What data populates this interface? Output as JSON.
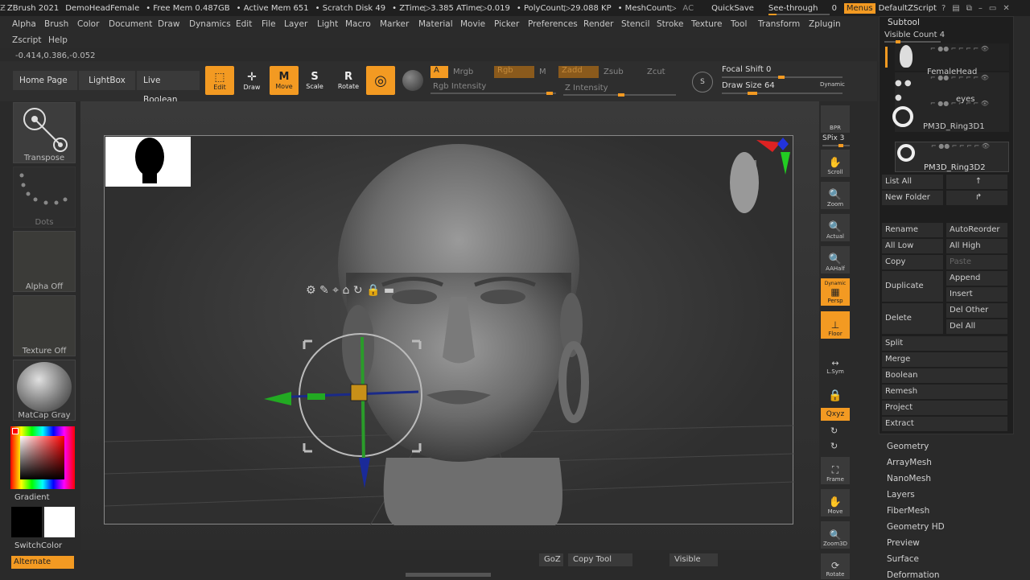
{
  "titlebar": {
    "app": "ZBrush 2021",
    "file": "DemoHeadFemale",
    "free_mem": "• Free Mem 0.487GB",
    "active_mem": "• Active Mem 651",
    "scratch": "• Scratch Disk 49",
    "ztime": "• ZTime▷3.385 ATime▷0.019",
    "polycount": "• PolyCount▷29.088 KP",
    "meshcount": "• MeshCount▷",
    "ac": "AC",
    "quicksave": "QuickSave",
    "seethrough": "See-through",
    "seethrough_value": "0",
    "menus": "Menus",
    "script": "DefaultZScript"
  },
  "menu": {
    "row1": [
      "Alpha",
      "Brush",
      "Color",
      "Document",
      "Draw",
      "Dynamics",
      "Edit",
      "File",
      "Layer",
      "Light",
      "Macro",
      "Marker",
      "Material",
      "Movie",
      "Picker",
      "Preferences",
      "Render",
      "Stencil",
      "Stroke",
      "Texture",
      "Tool",
      "Transform",
      "Zplugin"
    ],
    "row2": [
      "Zscript",
      "Help"
    ]
  },
  "coords": "-0.414,0.386,-0.052",
  "nav": {
    "home": "Home Page",
    "lightbox": "LightBox",
    "liveboolean": "Live Boolean"
  },
  "tools": {
    "edit": "Edit",
    "draw": "Draw",
    "move": "Move",
    "scale": "Scale",
    "rotate": "Rotate"
  },
  "params": {
    "a": "A",
    "mrgb": "Mrgb",
    "rgb": "Rgb",
    "m": "M",
    "zadd": "Zadd",
    "zsub": "Zsub",
    "zcut": "Zcut",
    "rgb_intensity": "Rgb Intensity",
    "z_intensity": "Z Intensity",
    "focal_shift_label": "Focal Shift",
    "focal_shift_value": "0",
    "draw_size_label": "Draw Size",
    "draw_size_value": "64",
    "dynamic": "Dynamic"
  },
  "left": {
    "transpose": "Transpose",
    "dots": "Dots",
    "alpha_off": "Alpha Off",
    "texture_off": "Texture Off",
    "matcap": "MatCap Gray",
    "gradient": "Gradient",
    "switchcolor": "SwitchColor",
    "alternate": "Alternate"
  },
  "shelf": {
    "bpr": "BPR",
    "spix": "SPix 3",
    "scroll": "Scroll",
    "zoom": "Zoom",
    "actual": "Actual",
    "aahalf": "AAHalf",
    "persp": "Persp",
    "dynamic": "Dynamic",
    "floor": "Floor",
    "lsym": "L.Sym",
    "xyz": "Qxyz",
    "frame": "Frame",
    "move": "Move",
    "zoom3d": "Zoom3D",
    "rotate": "Rotate"
  },
  "subtool": {
    "title": "Subtool",
    "visible_count": "Visible Count 4",
    "items": [
      "FemaleHead",
      "eyes",
      "PM3D_Ring3D1",
      "PM3D_Ring3D2"
    ],
    "list_all": "List All",
    "new_folder": "New Folder",
    "rename": "Rename",
    "autoreorder": "AutoReorder",
    "all_low": "All Low",
    "all_high": "All High",
    "copy": "Copy",
    "paste": "Paste",
    "duplicate": "Duplicate",
    "append": "Append",
    "insert": "Insert",
    "delete": "Delete",
    "del_other": "Del Other",
    "del_all": "Del All",
    "split": "Split",
    "merge": "Merge",
    "boolean": "Boolean",
    "remesh": "Remesh",
    "project": "Project",
    "extract": "Extract"
  },
  "palettes": [
    "Geometry",
    "ArrayMesh",
    "NanoMesh",
    "Layers",
    "FiberMesh",
    "Geometry HD",
    "Preview",
    "Surface",
    "Deformation"
  ],
  "bottom": {
    "goz": "GoZ",
    "copytool": "Copy Tool",
    "visible": "Visible"
  }
}
